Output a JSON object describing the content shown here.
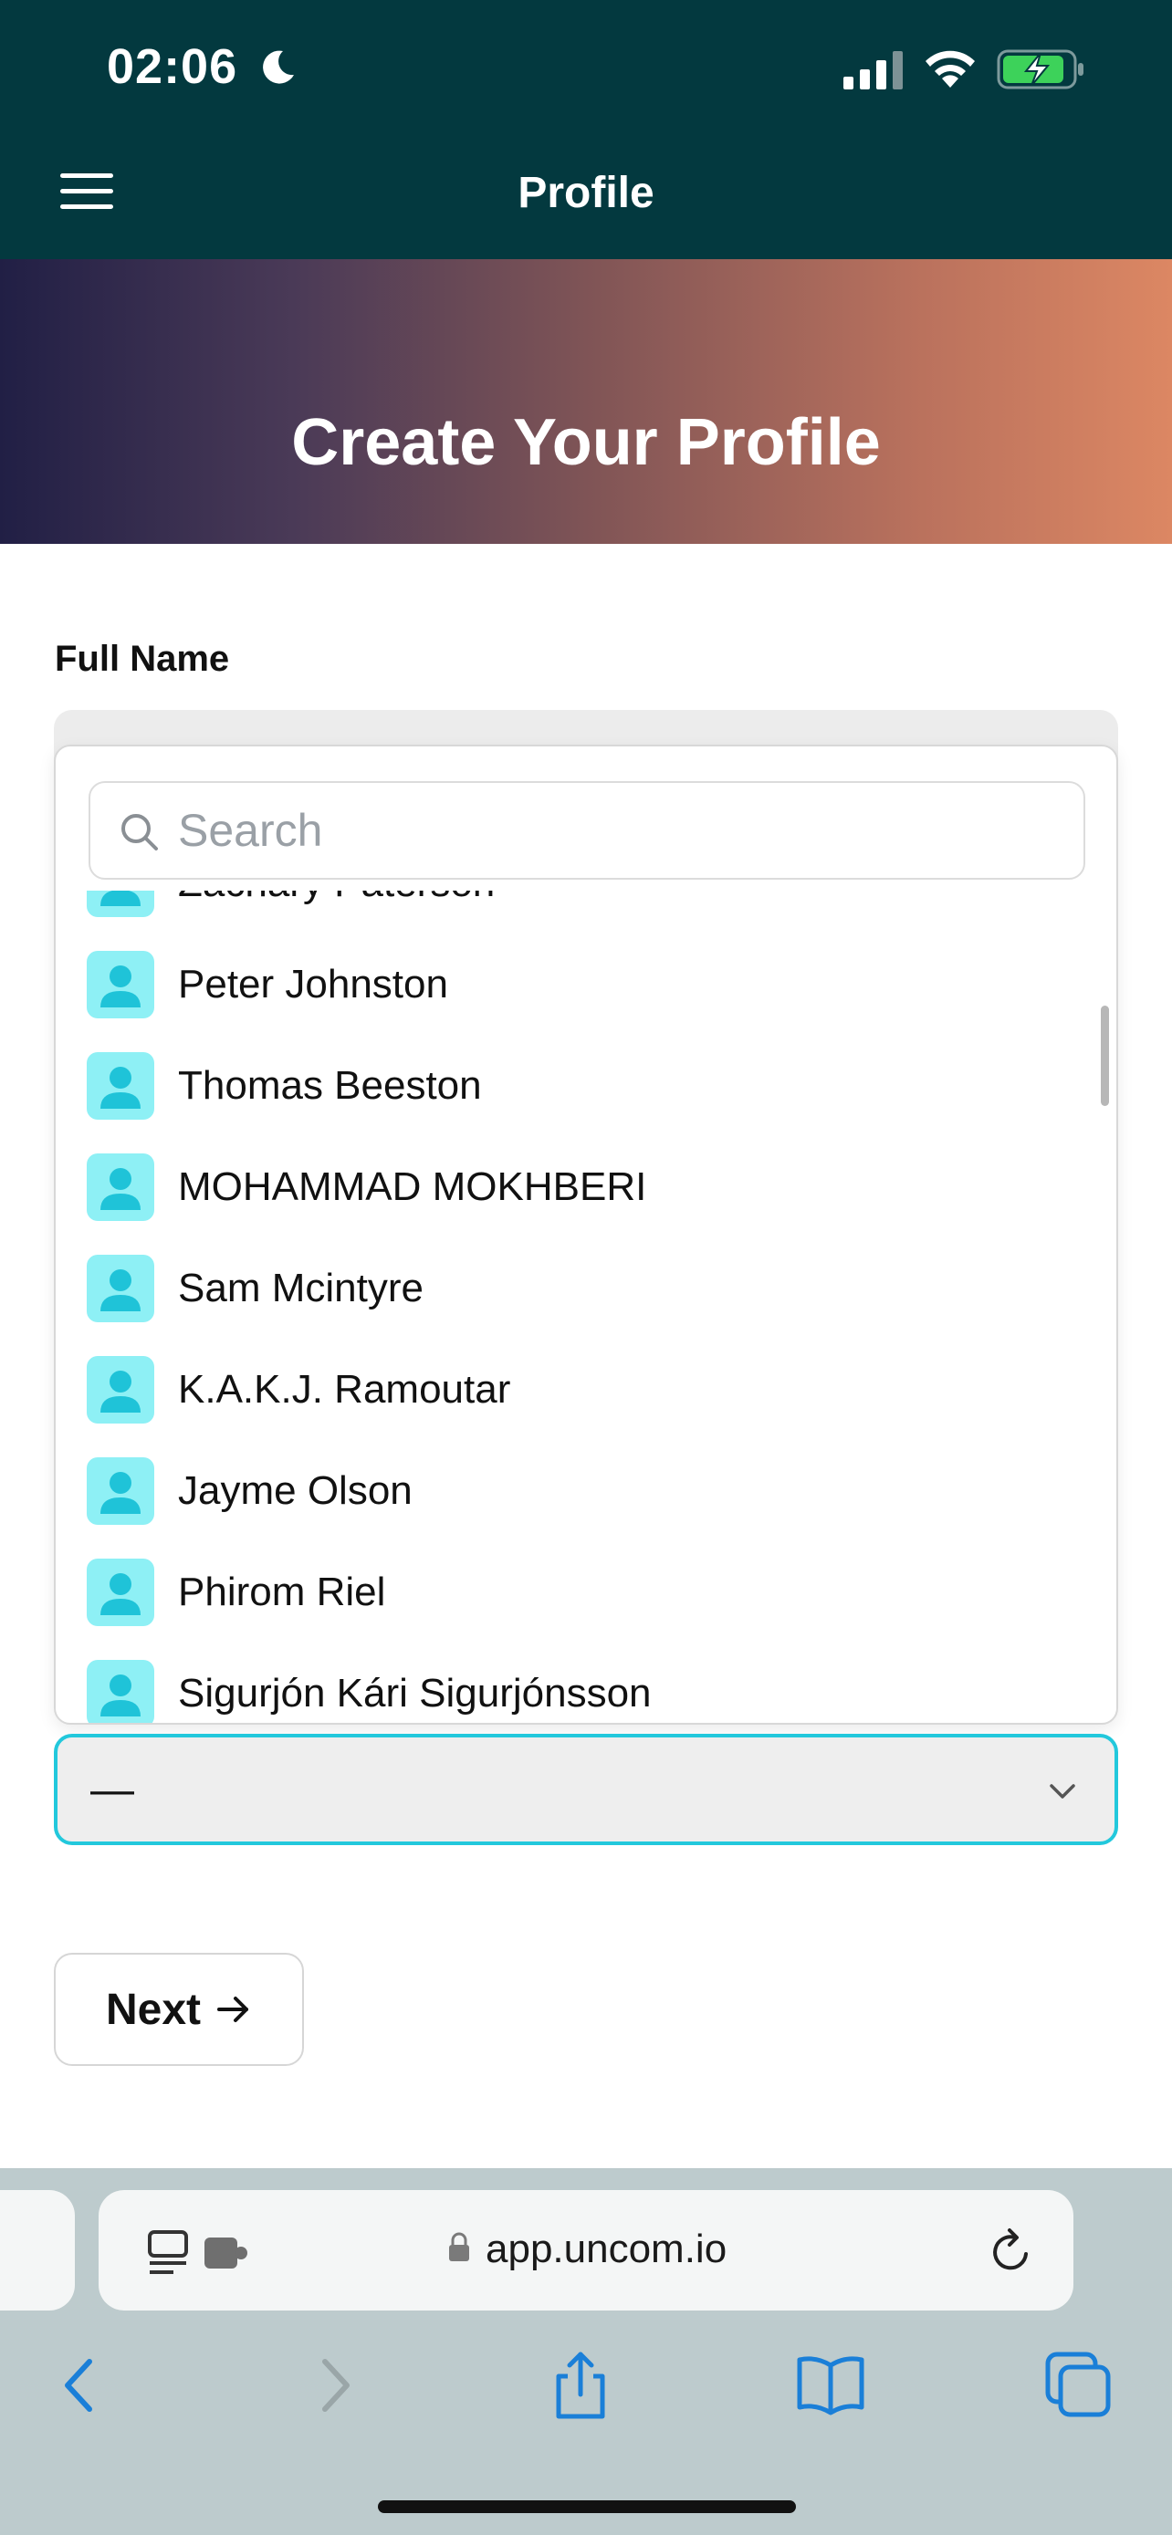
{
  "status_bar": {
    "time": "02:06"
  },
  "header": {
    "title": "Profile"
  },
  "banner": {
    "title": "Create Your Profile"
  },
  "form": {
    "full_name_label": "Full Name",
    "search_placeholder": "Search",
    "options": [
      "Zachary Paterson",
      "Peter Johnston",
      "Thomas Beeston",
      "MOHAMMAD MOKHBERI",
      "Sam Mcintyre",
      "K.A.K.J. Ramoutar",
      "Jayme Olson",
      "Phirom Riel",
      "Sigurjón Kári Sigurjónsson"
    ],
    "select_value": "—",
    "next_label": "Next"
  },
  "browser": {
    "url": "app.uncom.io"
  },
  "colors": {
    "header_bg": "#03393f",
    "accent": "#22c8dc",
    "avatar_bg": "#8ef0f5",
    "safari_blue": "#1a7fd8"
  },
  "icons": [
    "moon-icon",
    "signal-icon",
    "wifi-icon",
    "battery-icon",
    "hamburger-icon",
    "search-icon",
    "user-avatar-icon",
    "chevron-down-icon",
    "arrow-right-icon",
    "reader-icon",
    "lock-icon",
    "reload-icon",
    "back-icon",
    "forward-icon",
    "share-icon",
    "bookmarks-icon",
    "tabs-icon"
  ]
}
